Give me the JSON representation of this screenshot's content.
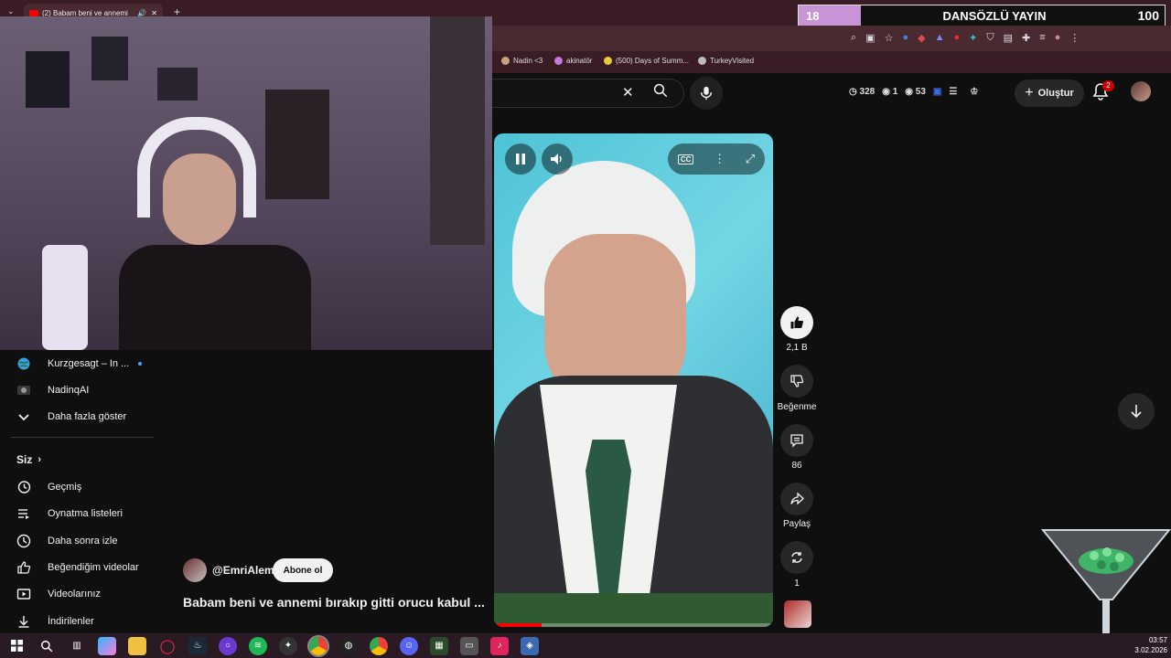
{
  "browser": {
    "tab_title": "(2) Babam beni ve annemi",
    "new_tab": "+",
    "bookmarks": [
      {
        "label": "Nadin <3",
        "color": "#c9a37b"
      },
      {
        "label": "akinatör",
        "color": "#c27bd9"
      },
      {
        "label": "(500) Days of Summ...",
        "color": "#e8c840"
      },
      {
        "label": "TurkeyVisited",
        "color": "#bbbbbb"
      }
    ]
  },
  "overlay": {
    "left_count": "18",
    "title": "DANSÖZLÜ YAYIN",
    "right_count": "100"
  },
  "header": {
    "stats": [
      {
        "icon": "clock-icon",
        "value": "328"
      },
      {
        "icon": "eye-icon",
        "value": "1"
      },
      {
        "icon": "eye-icon",
        "value": "53"
      }
    ],
    "create_label": "Oluştur",
    "notification_count": "2"
  },
  "sidebar": {
    "subscriptions": [
      {
        "label": "Kurzgesagt – In ...",
        "icon": "globe-icon"
      },
      {
        "label": "NadinqAI",
        "icon": "avatar-icon"
      },
      {
        "label": "Daha fazla göster",
        "icon": "chevron-down-icon"
      }
    ],
    "you_section": "Siz",
    "you_items": [
      {
        "label": "Geçmiş",
        "icon": "history-icon"
      },
      {
        "label": "Oynatma listeleri",
        "icon": "playlist-icon"
      },
      {
        "label": "Daha sonra izle",
        "icon": "clock-icon"
      },
      {
        "label": "Beğendiğim videolar",
        "icon": "thumbs-up-icon"
      },
      {
        "label": "Videolarınız",
        "icon": "video-icon"
      },
      {
        "label": "İndirilenler",
        "icon": "download-icon"
      }
    ]
  },
  "short": {
    "channel": "@EmriAlem",
    "subscribe_label": "Abone ol",
    "title": "Babam beni ve annemi bırakıp gitti orucu kabul ...",
    "progress": 0.17
  },
  "actions": {
    "like_count": "2,1 B",
    "dislike_label": "Beğenme",
    "comment_count": "86",
    "share_label": "Paylaş",
    "remix_count": "1"
  },
  "taskbar": {
    "time": "03:57",
    "date": "3.02.2026"
  }
}
